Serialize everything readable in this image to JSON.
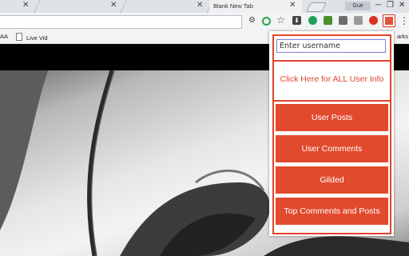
{
  "browser": {
    "tabs": [
      {
        "label": ""
      },
      {
        "label": ""
      },
      {
        "label": "Blank New Tab"
      }
    ],
    "guest_label": "Gue",
    "window_controls": [
      "─",
      "❐",
      "✕"
    ],
    "bookmarks": [
      {
        "label": "AA"
      },
      {
        "label": "Live Vid"
      }
    ],
    "bookmarks_right_label": "arks",
    "toolbar_icons": [
      "cs-extension-icon",
      "green-ring-extension-icon",
      "bookmark-star-icon",
      "download-extension-icon",
      "green-dot-extension-icon",
      "extension-icon",
      "extension-icon",
      "extension-icon",
      "red-circle-extension-icon",
      "reddit-user-info-extension-icon",
      "menu-icon"
    ]
  },
  "popup": {
    "username_placeholder": "Enter username",
    "all_info_link": "Click Here for ALL User Info",
    "buttons": [
      {
        "label": "User Posts"
      },
      {
        "label": "User Comments"
      },
      {
        "label": "Gilded"
      },
      {
        "label": "Top Comments and Posts"
      }
    ],
    "accent_color": "#e24a2e"
  }
}
